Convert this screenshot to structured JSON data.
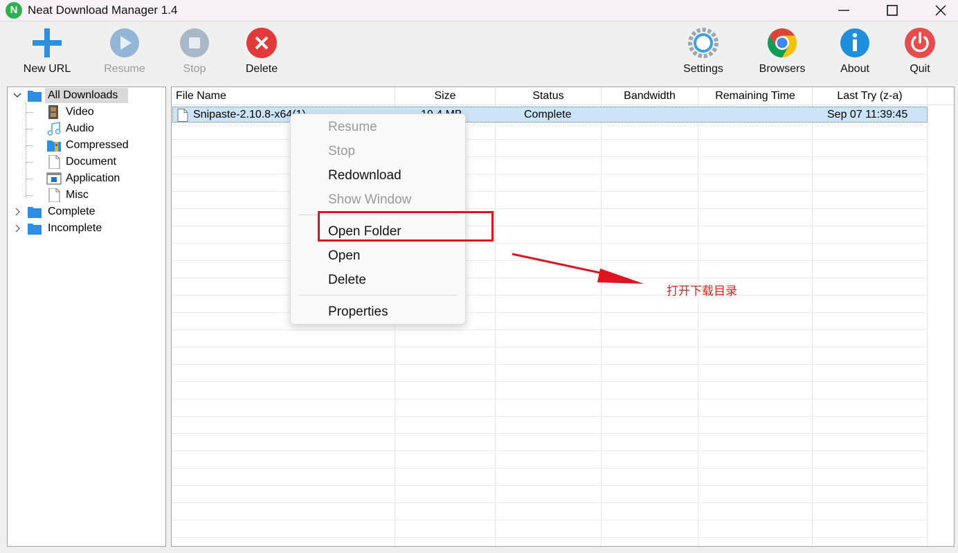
{
  "window": {
    "title": "Neat Download Manager 1.4",
    "app_icon_letter": "N"
  },
  "toolbar": {
    "left": [
      {
        "label": "New URL",
        "icon": "plus-icon",
        "enabled": true
      },
      {
        "label": "Resume",
        "icon": "play-icon",
        "enabled": false
      },
      {
        "label": "Stop",
        "icon": "stop-icon",
        "enabled": false
      },
      {
        "label": "Delete",
        "icon": "delete-x-icon",
        "enabled": true
      }
    ],
    "right": [
      {
        "label": "Settings",
        "icon": "gear-icon"
      },
      {
        "label": "Browsers",
        "icon": "chrome-icon"
      },
      {
        "label": "About",
        "icon": "info-icon"
      },
      {
        "label": "Quit",
        "icon": "power-icon"
      }
    ]
  },
  "tree": {
    "root": {
      "label": "All Downloads",
      "expanded": true,
      "selected": true
    },
    "children": [
      {
        "label": "Video",
        "icon": "film-icon"
      },
      {
        "label": "Audio",
        "icon": "music-note-icon"
      },
      {
        "label": "Compressed",
        "icon": "archive-icon"
      },
      {
        "label": "Document",
        "icon": "document-icon"
      },
      {
        "label": "Application",
        "icon": "application-icon"
      },
      {
        "label": "Misc",
        "icon": "file-icon"
      }
    ],
    "groups": [
      {
        "label": "Complete",
        "expanded": false
      },
      {
        "label": "Incomplete",
        "expanded": false
      }
    ]
  },
  "list": {
    "columns": [
      "File Name",
      "Size",
      "Status",
      "Bandwidth",
      "Remaining Time",
      "Last Try (z-a)"
    ],
    "rows": [
      {
        "file_name": "Snipaste-2.10.8-x64(1).zip",
        "file_name_visible": "Snipaste-2.10.8-x64(1)...",
        "size": "19.4 MB",
        "status": "Complete",
        "bandwidth": "",
        "remaining_time": "",
        "last_try": "Sep 07 11:39:45"
      }
    ]
  },
  "context_menu": {
    "items": [
      {
        "label": "Resume",
        "enabled": false
      },
      {
        "label": "Stop",
        "enabled": false
      },
      {
        "label": "Redownload",
        "enabled": true
      },
      {
        "label": "Show Window",
        "enabled": false
      },
      {
        "label": "Open Folder",
        "enabled": true,
        "highlighted": true
      },
      {
        "label": "Open",
        "enabled": true
      },
      {
        "label": "Delete",
        "enabled": true
      },
      {
        "label": "Properties",
        "enabled": true
      }
    ]
  },
  "annotation": {
    "text": "打开下载目录",
    "color": "#d8261f"
  },
  "colors": {
    "accent_blue": "#2f8fdf",
    "delete_red": "#e23a3a",
    "selection": "#cce4f7",
    "highlight_red": "#e0141e"
  }
}
